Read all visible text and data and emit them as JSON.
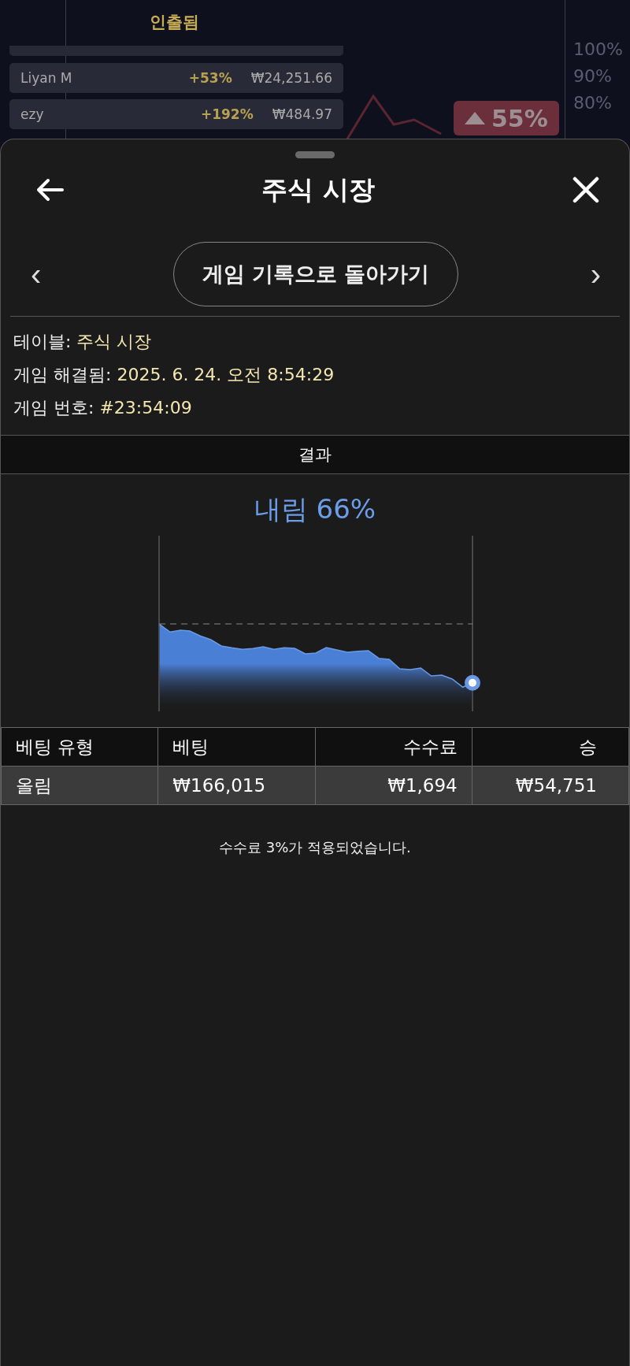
{
  "background": {
    "column_title": "인출됨",
    "rows": [
      {
        "name": "Liyan M",
        "multiplier": "+53%",
        "amount": "₩24,251.66"
      },
      {
        "name": "ezy",
        "multiplier": "+192%",
        "amount": "₩484.97"
      }
    ],
    "axis_labels": [
      "100%",
      "90%",
      "80%"
    ],
    "badge": "55%"
  },
  "sheet": {
    "title": "주식 시장",
    "nav": {
      "prev": "‹",
      "button": "게임 기록으로 돌아가기",
      "next": "›"
    },
    "info": [
      {
        "label": "테이블:",
        "value": "주식 시장"
      },
      {
        "label": "게임 해결됨:",
        "value": "2025. 6. 24. 오전 8:54:29"
      },
      {
        "label": "게임 번호:",
        "value": "#23:54:09"
      }
    ],
    "result_header": "결과",
    "outcome": "내림 66%",
    "table": {
      "columns": [
        "베팅 유형",
        "베팅",
        "수수료",
        "승"
      ],
      "rows": [
        [
          "올림",
          "₩166,015",
          "₩1,694",
          "₩54,751"
        ]
      ]
    },
    "note": "수수료 3%가 적용되었습니다."
  }
}
